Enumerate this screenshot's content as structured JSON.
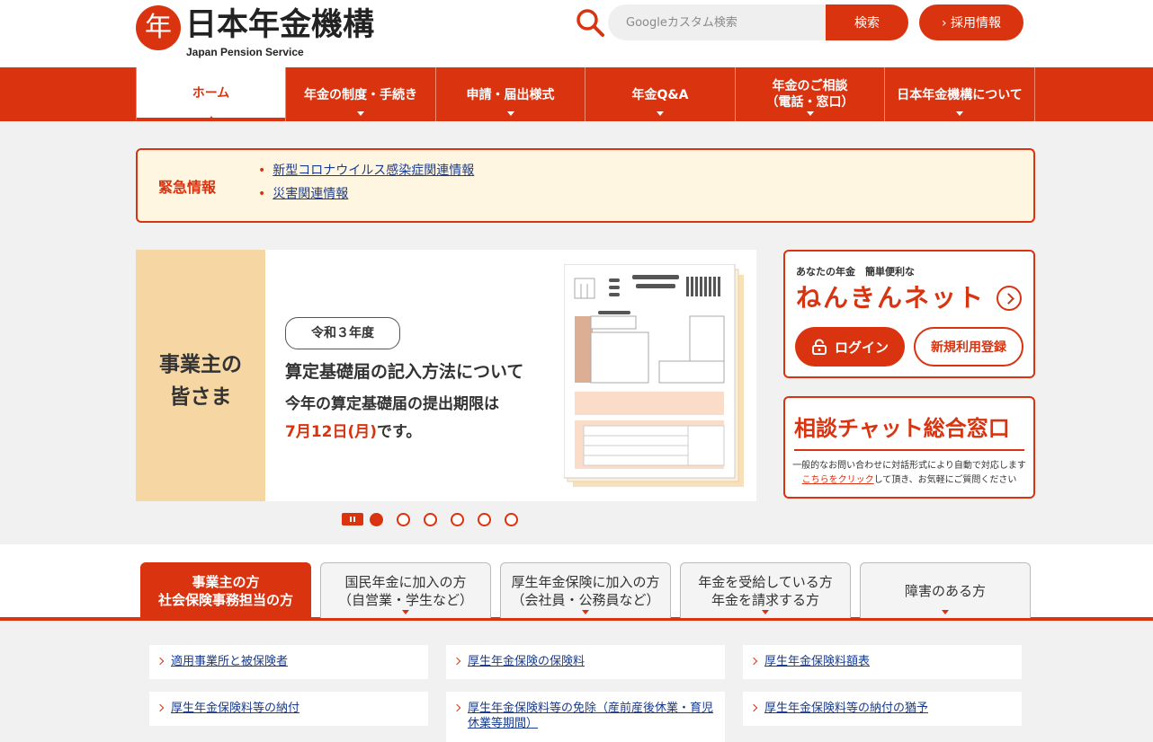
{
  "header": {
    "logo_mark": "年",
    "logo_text": "日本年金機構",
    "logo_sub": "Japan Pension Service",
    "search_placeholder": "Googleカスタム検索",
    "search_button": "検索",
    "recruit_button": "› 採用情報"
  },
  "nav": {
    "items": [
      {
        "label": "ホーム",
        "active": true
      },
      {
        "label": "年金の制度・手続き"
      },
      {
        "label": "申請・届出様式"
      },
      {
        "label": "年金Q&A"
      },
      {
        "label": "年金のご相談",
        "label2": "（電話・窓口）"
      },
      {
        "label": "日本年金機構について"
      }
    ]
  },
  "emergency": {
    "title": "緊急情報",
    "links": [
      "新型コロナウイルス感染症関連情報",
      "災害関連情報"
    ]
  },
  "banner": {
    "side_line1": "事業主の",
    "side_line2": "皆さま",
    "badge": "令和３年度",
    "headline": "算定基礎届の記入方法について",
    "sub": "今年の算定基礎届の提出期限は",
    "date": "7月12日(月)",
    "date_suffix": "です。"
  },
  "carousel": {
    "dots": 6,
    "active_index": 0
  },
  "nenkin": {
    "sub": "あなたの年金　簡単便利な",
    "title": "ねんきんネット",
    "login": "ログイン",
    "register": "新規利用登録"
  },
  "chat": {
    "title": "相談チャット総合窓口",
    "desc1": "一般的なお問い合わせに対話形式により自動で対応します",
    "link": "こちらをクリック",
    "desc2": "して頂き、お気軽にご質問ください"
  },
  "tabs": [
    {
      "line1": "事業主の方",
      "line2": "社会保険事務担当の方",
      "active": true
    },
    {
      "line1": "国民年金に加入の方",
      "line2": "（自営業・学生など）"
    },
    {
      "line1": "厚生年金保険に加入の方",
      "line2": "（会社員・公務員など）"
    },
    {
      "line1": "年金を受給している方",
      "line2": "年金を請求する方"
    },
    {
      "line1": "障害のある方",
      "line2": ""
    }
  ],
  "links": [
    "適用事業所と被保険者",
    "厚生年金保険の保険料",
    "厚生年金保険料額表",
    "厚生年金保険料等の納付",
    "厚生年金保険料等の免除（産前産後休業・育児休業等期間）",
    "厚生年金保険料等の納付の猶予"
  ],
  "colors": {
    "accent": "#d9330f",
    "banner_side": "#f6d7a4",
    "emergency_bg": "#fff6e2",
    "link": "#1a3c8e"
  }
}
